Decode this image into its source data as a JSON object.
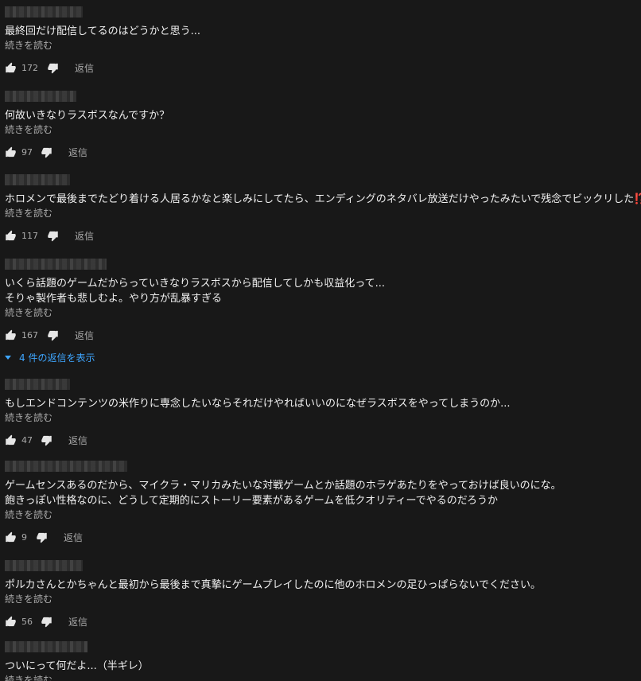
{
  "ui": {
    "read_more": "続きを読む",
    "reply": "返信",
    "like_icon": "thumbs-up-icon",
    "dislike_icon": "thumbs-down-icon",
    "accent_color": "#3ea6ff",
    "background_color": "#181818"
  },
  "comments": [
    {
      "lines": [
        "最終回だけ配信してるのはどうかと思う..."
      ],
      "likes": "172"
    },
    {
      "lines": [
        "何故いきなりラスボスなんですか？"
      ],
      "likes": "97"
    },
    {
      "lines": [
        "ホロメンで最後までたどり着ける人居るかなと楽しみにしてたら、エンディングのネタバレ放送だけやったみたいで残念でビックリした"
      ],
      "emoji": "⁉️",
      "likes": "117"
    },
    {
      "lines": [
        "いくら話題のゲームだからっていきなりラスボスから配信してしかも収益化って...",
        "そりゃ製作者も悲しむよ。やり方が乱暴すぎる"
      ],
      "likes": "167",
      "replies_label": "4 件の返信を表示"
    },
    {
      "lines": [
        "もしエンドコンテンツの米作りに専念したいならそれだけやればいいのになぜラスボスをやってしまうのか..."
      ],
      "likes": "47"
    },
    {
      "lines": [
        "ゲームセンスあるのだから、マイクラ・マリカみたいな対戦ゲームとか話題のホラゲあたりをやっておけば良いのにな。",
        "飽きっぽい性格なのに、どうして定期的にストーリー要素があるゲームを低クオリティーでやるのだろうか"
      ],
      "likes": "9"
    },
    {
      "lines": [
        "ポルカさんとかちゃんと最初から最後まで真摯にゲームプレイしたのに他のホロメンの足ひっぱらないでください。"
      ],
      "likes": "56"
    },
    {
      "lines": [
        "ついにって何だよ...（半ギレ）"
      ],
      "likes": ""
    }
  ]
}
